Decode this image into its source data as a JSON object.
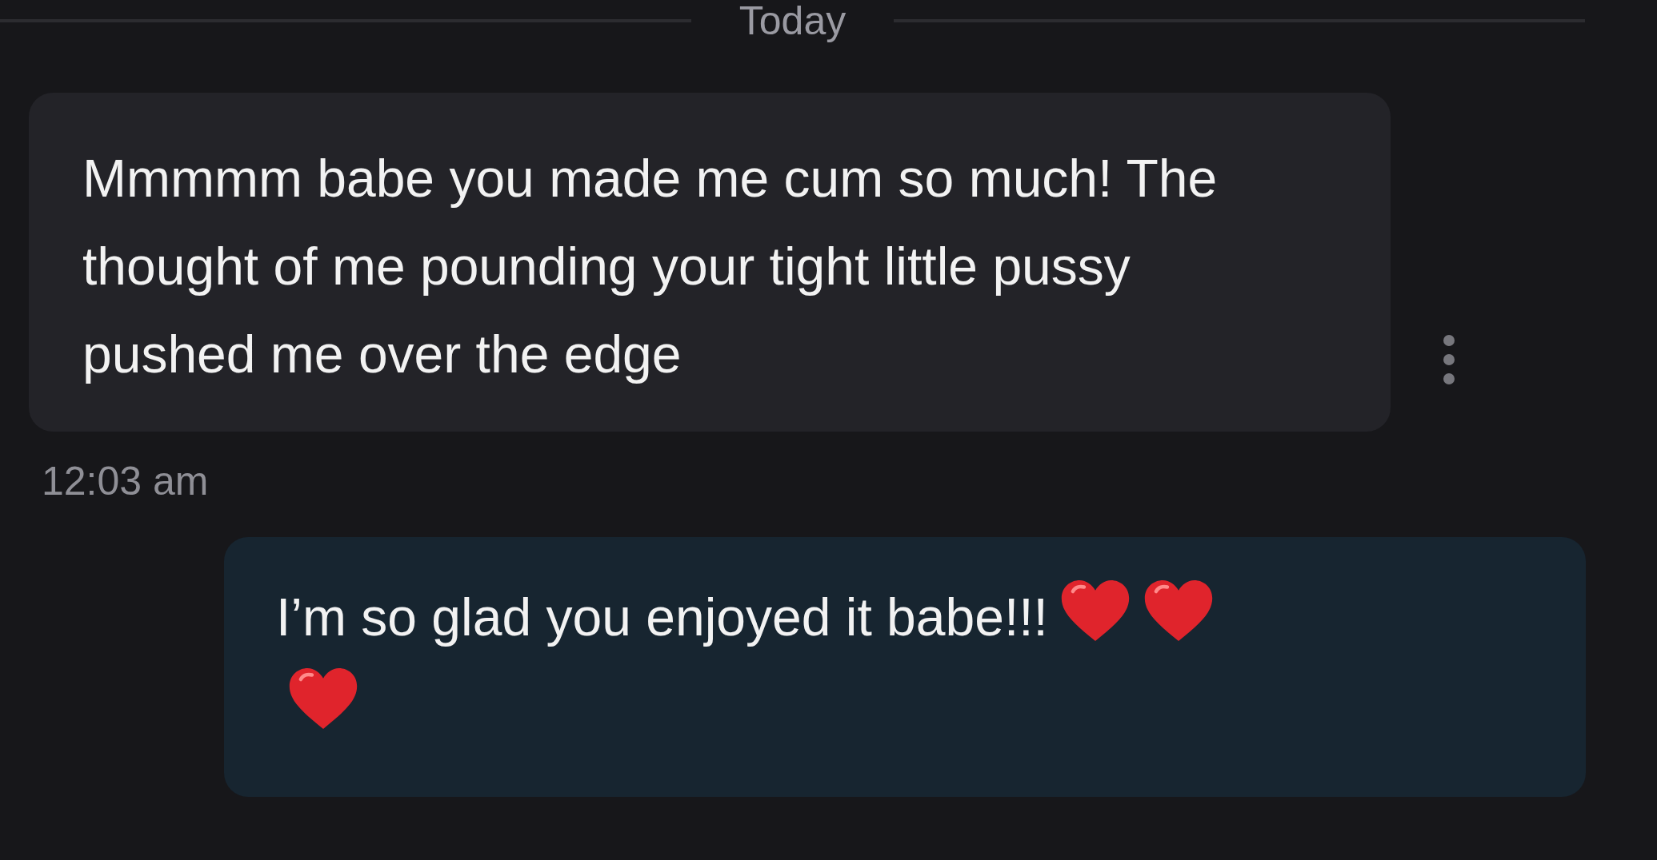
{
  "date_divider": {
    "label": "Today"
  },
  "messages": [
    {
      "kind": "received",
      "text": "Mmmmm babe you made me cum so much! The thought of me pounding your tight little pussy pushed me over the edge",
      "time": "12:03 am"
    },
    {
      "kind": "sent",
      "text": "I’m so glad you enjoyed it babe!!!"
    }
  ]
}
